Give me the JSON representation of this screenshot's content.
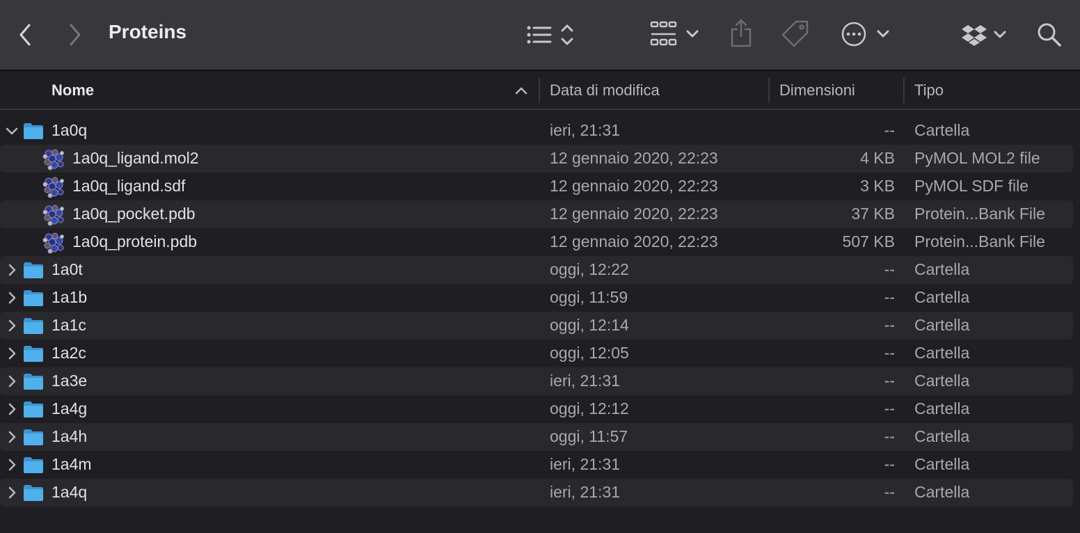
{
  "window": {
    "title": "Proteins",
    "icons": [
      "back-icon",
      "forward-icon",
      "list-view-icon",
      "sort-stepper-icon",
      "grid-view-icon",
      "share-icon",
      "tag-icon",
      "more-icon",
      "dropbox-icon",
      "search-icon"
    ]
  },
  "columns": {
    "name": "Nome",
    "date": "Data di modifica",
    "size": "Dimensioni",
    "kind": "Tipo"
  },
  "rows": [
    {
      "name": "1a0q",
      "date": "ieri, 21:31",
      "size": "--",
      "kind": "Cartella",
      "type": "folder",
      "expanded": true
    },
    {
      "name": "1a0q_ligand.mol2",
      "date": "12 gennaio 2020, 22:23",
      "size": "4 KB",
      "kind": "PyMOL MOL2 file",
      "type": "file"
    },
    {
      "name": "1a0q_ligand.sdf",
      "date": "12 gennaio 2020, 22:23",
      "size": "3 KB",
      "kind": "PyMOL SDF file",
      "type": "file"
    },
    {
      "name": "1a0q_pocket.pdb",
      "date": "12 gennaio 2020, 22:23",
      "size": "37 KB",
      "kind": "Protein...Bank File",
      "type": "file"
    },
    {
      "name": "1a0q_protein.pdb",
      "date": "12 gennaio 2020, 22:23",
      "size": "507 KB",
      "kind": "Protein...Bank File",
      "type": "file"
    },
    {
      "name": "1a0t",
      "date": "oggi, 12:22",
      "size": "--",
      "kind": "Cartella",
      "type": "folder",
      "expanded": false
    },
    {
      "name": "1a1b",
      "date": "oggi, 11:59",
      "size": "--",
      "kind": "Cartella",
      "type": "folder",
      "expanded": false
    },
    {
      "name": "1a1c",
      "date": "oggi, 12:14",
      "size": "--",
      "kind": "Cartella",
      "type": "folder",
      "expanded": false
    },
    {
      "name": "1a2c",
      "date": "oggi, 12:05",
      "size": "--",
      "kind": "Cartella",
      "type": "folder",
      "expanded": false
    },
    {
      "name": "1a3e",
      "date": "ieri, 21:31",
      "size": "--",
      "kind": "Cartella",
      "type": "folder",
      "expanded": false
    },
    {
      "name": "1a4g",
      "date": "oggi, 12:12",
      "size": "--",
      "kind": "Cartella",
      "type": "folder",
      "expanded": false
    },
    {
      "name": "1a4h",
      "date": "oggi, 11:57",
      "size": "--",
      "kind": "Cartella",
      "type": "folder",
      "expanded": false
    },
    {
      "name": "1a4m",
      "date": "ieri, 21:31",
      "size": "--",
      "kind": "Cartella",
      "type": "folder",
      "expanded": false
    },
    {
      "name": "1a4q",
      "date": "ieri, 21:31",
      "size": "--",
      "kind": "Cartella",
      "type": "folder",
      "expanded": false
    }
  ],
  "colors": {
    "toolbar": "#38373c",
    "background": "#1f1e23",
    "row_alt": "#29282d",
    "folder": "#4fb0ec"
  }
}
